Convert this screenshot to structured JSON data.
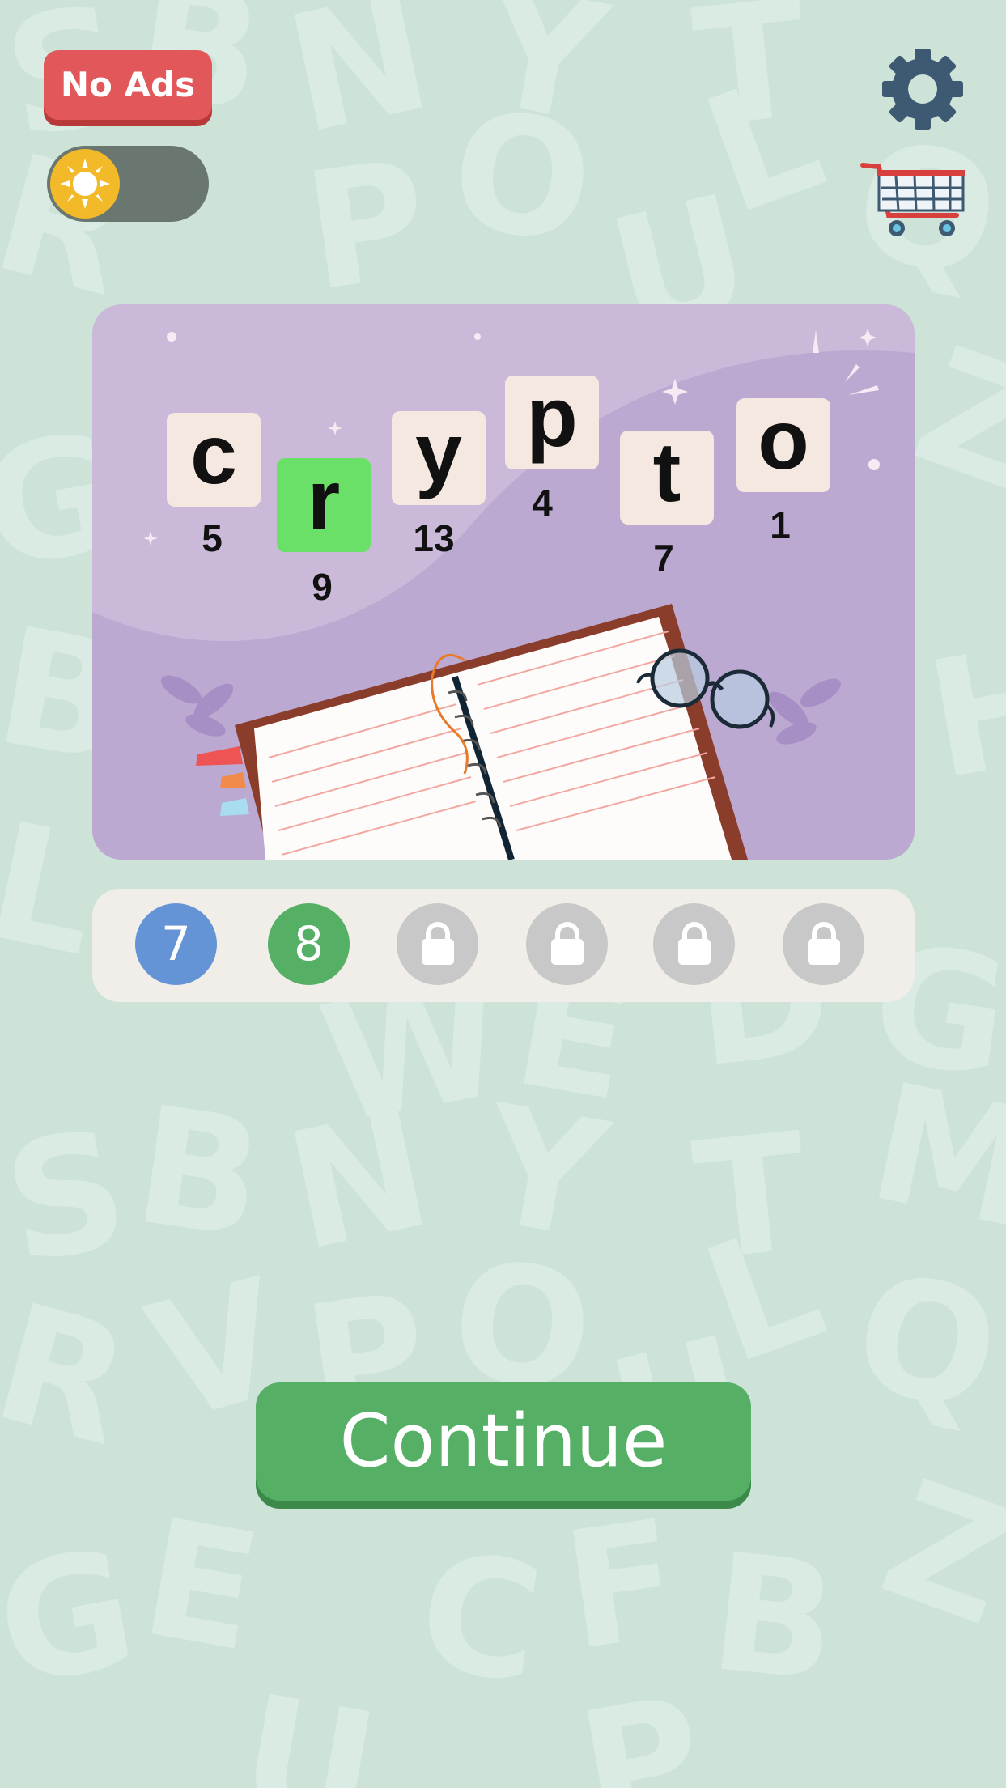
{
  "header": {
    "no_ads_label": "No Ads",
    "theme_toggle": {
      "mode": "light",
      "icon": "sun-icon"
    },
    "settings_icon": "gear-icon",
    "shop_icon": "shopping-cart-icon"
  },
  "puzzle": {
    "letters": [
      {
        "char": "c",
        "number": "5",
        "highlighted": false
      },
      {
        "char": "r",
        "number": "9",
        "highlighted": true
      },
      {
        "char": "y",
        "number": "13",
        "highlighted": false
      },
      {
        "char": "p",
        "number": "4",
        "highlighted": false
      },
      {
        "char": "t",
        "number": "7",
        "highlighted": false
      },
      {
        "char": "o",
        "number": "1",
        "highlighted": false
      }
    ],
    "illustration": "open-notebook-with-glasses"
  },
  "levels": [
    {
      "label": "7",
      "state": "completed",
      "color": "#6493d6"
    },
    {
      "label": "8",
      "state": "current",
      "color": "#55b065"
    },
    {
      "label": "",
      "state": "locked"
    },
    {
      "label": "",
      "state": "locked"
    },
    {
      "label": "",
      "state": "locked"
    },
    {
      "label": "",
      "state": "locked"
    }
  ],
  "continue_label": "Continue",
  "colors": {
    "background": "#cde3d8",
    "accent_green": "#55b065",
    "no_ads_red": "#e2585a",
    "highlight_tile": "#6ae068"
  }
}
